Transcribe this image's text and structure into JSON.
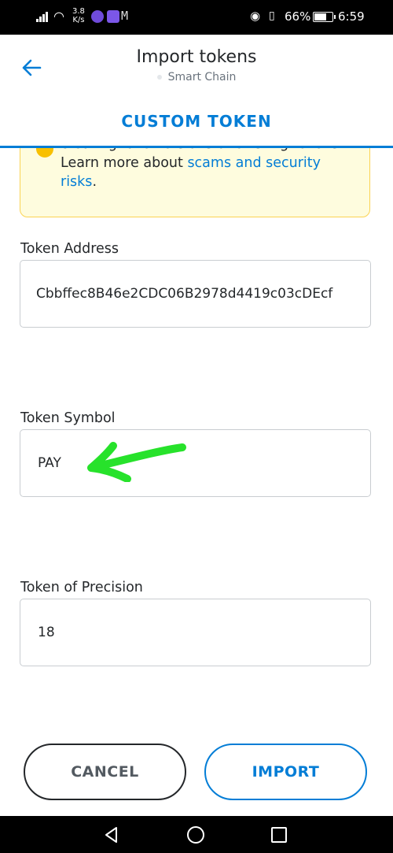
{
  "status_bar": {
    "net_speed_top": "3.8",
    "net_speed_bottom": "K/s",
    "battery": "66%",
    "time": "6:59"
  },
  "header": {
    "title": "Import tokens",
    "network": "Smart Chain",
    "back_icon": "arrow-left-icon"
  },
  "tabs": {
    "active": "CUSTOM TOKEN"
  },
  "warning": {
    "line_text": "creating fake versions of existing tokens. Learn more about ",
    "link_text": "scams and security risks",
    "end_text": "."
  },
  "form": {
    "address": {
      "label": "Token Address",
      "value": "Cbbffec8B46e2CDC06B2978d4419c03cDEcf"
    },
    "symbol": {
      "label": "Token Symbol",
      "value": "PAY"
    },
    "precision": {
      "label": "Token of Precision",
      "value": "18"
    }
  },
  "actions": {
    "cancel": "CANCEL",
    "import": "IMPORT"
  },
  "colors": {
    "accent": "#037dd6",
    "warning_bg": "#fefcde",
    "warning_border": "#fbd352",
    "annotation_arrow": "#27e22b"
  }
}
